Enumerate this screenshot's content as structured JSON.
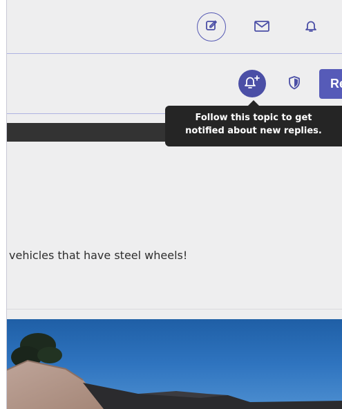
{
  "header": {
    "icons": {
      "compose": "compose-icon",
      "messages": "mail-icon",
      "notifications": "bell-icon"
    }
  },
  "topic_controls": {
    "follow_icon": "bell-plus-icon",
    "shield_icon": "shield-icon",
    "reply_label": "Re"
  },
  "tooltip": {
    "line1": "Follow this topic to get",
    "line2": "notified about new replies."
  },
  "post": {
    "text": "vehicles that have steel wheels!"
  },
  "colors": {
    "accent": "#4b4fa6",
    "button": "#565bb8",
    "tooltip_bg": "#252525",
    "background": "#eeeeef"
  }
}
